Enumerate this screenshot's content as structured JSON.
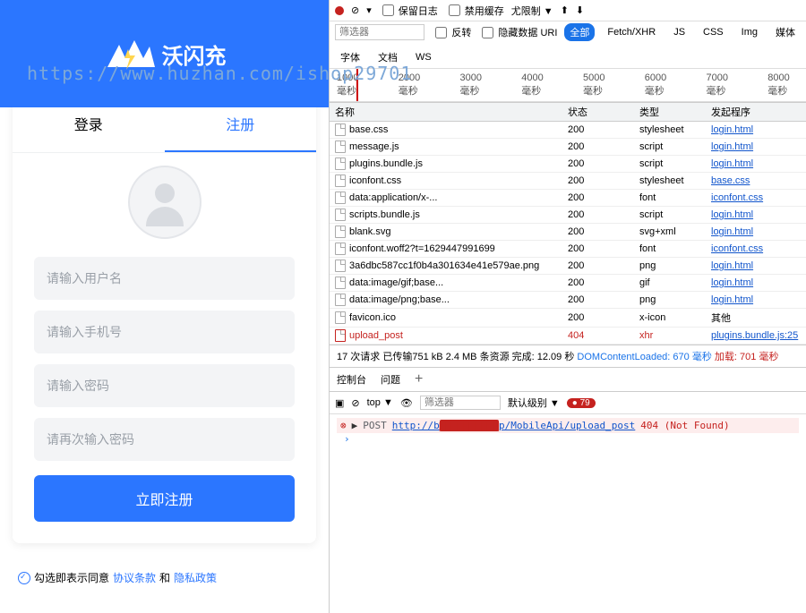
{
  "watermark_url": "https://www.huzhan.com/ishop29701",
  "mobile": {
    "logo_text": "沃闪充",
    "tab_login": "登录",
    "tab_register": "注册",
    "placeholders": {
      "username": "请输入用户名",
      "phone": "请输入手机号",
      "password": "请输入密码",
      "password2": "请再次输入密码"
    },
    "submit": "立即注册",
    "agree_pre": "勾选即表示同意",
    "agree_terms": "协议条款",
    "agree_and": "和",
    "agree_privacy": "隐私政策"
  },
  "devtools": {
    "toolbar_top": [
      "保留日志",
      "禁用缓存",
      "尤限制 ▼"
    ],
    "filter_placeholder": "筛选器",
    "invert": "反转",
    "hide_data": "隐藏数据 URI",
    "types": [
      "全部",
      "Fetch/XHR",
      "JS",
      "CSS",
      "Img",
      "媒体",
      "字体",
      "文档",
      "WS"
    ],
    "timeline": [
      "1000 毫秒",
      "2000 毫秒",
      "3000 毫秒",
      "4000 毫秒",
      "5000 毫秒",
      "6000 毫秒",
      "7000 毫秒",
      "8000 毫秒"
    ],
    "headers": {
      "name": "名称",
      "status": "状态",
      "type": "类型",
      "initiator": "发起程序"
    },
    "rows": [
      {
        "n": "base.css",
        "s": "200",
        "t": "stylesheet",
        "i": "login.html"
      },
      {
        "n": "message.js",
        "s": "200",
        "t": "script",
        "i": "login.html"
      },
      {
        "n": "plugins.bundle.js",
        "s": "200",
        "t": "script",
        "i": "login.html"
      },
      {
        "n": "iconfont.css",
        "s": "200",
        "t": "stylesheet",
        "i": "base.css"
      },
      {
        "n": "data:application/x-...",
        "s": "200",
        "t": "font",
        "i": "iconfont.css"
      },
      {
        "n": "scripts.bundle.js",
        "s": "200",
        "t": "script",
        "i": "login.html"
      },
      {
        "n": "blank.svg",
        "s": "200",
        "t": "svg+xml",
        "i": "login.html"
      },
      {
        "n": "iconfont.woff2?t=1629447991699",
        "s": "200",
        "t": "font",
        "i": "iconfont.css"
      },
      {
        "n": "3a6dbc587cc1f0b4a301634e41e579ae.png",
        "s": "200",
        "t": "png",
        "i": "login.html"
      },
      {
        "n": "data:image/gif;base...",
        "s": "200",
        "t": "gif",
        "i": "login.html"
      },
      {
        "n": "data:image/png;base...",
        "s": "200",
        "t": "png",
        "i": "login.html"
      },
      {
        "n": "favicon.ico",
        "s": "200",
        "t": "x-icon",
        "i": "其他"
      },
      {
        "n": "upload_post",
        "s": "404",
        "t": "xhr",
        "i": "plugins.bundle.js:25",
        "err": true
      }
    ],
    "summary": {
      "req": "17 次请求",
      "transfer": "已传输751 kB",
      "res": "2.4 MB 条资源",
      "finish": "完成: 12.09 秒",
      "dcl_l": "DOMContentLoaded:",
      "dcl_v": "670 毫秒",
      "load_l": "加载:",
      "load_v": "701 毫秒"
    },
    "console_tabs": [
      "控制台",
      "问题"
    ],
    "console": {
      "top": "top ▼",
      "filter": "筛选器",
      "level": "默认级别 ▼",
      "errors": "79",
      "method": "POST",
      "pre": "http://b",
      "mid": "▆▆▆▆▆▆▆▆▆▆",
      "post": "p/MobileApi/upload_post",
      "status": "404 (Not Found)"
    }
  }
}
